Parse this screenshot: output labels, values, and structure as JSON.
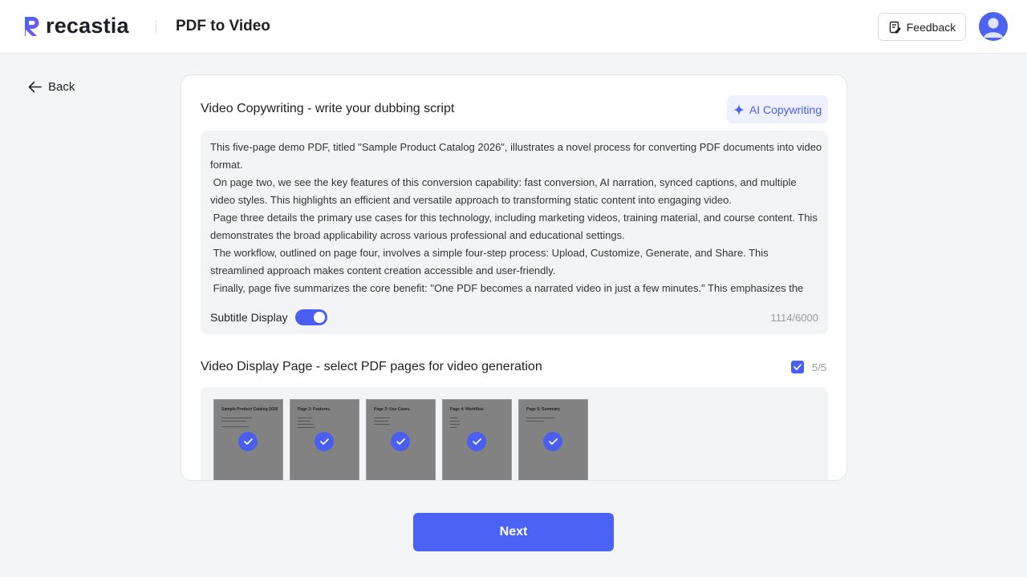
{
  "header": {
    "logo_text": "recastia",
    "page_title": "PDF to Video",
    "feedback_label": "Feedback",
    "avatar_icon": "user-avatar-icon"
  },
  "nav": {
    "back_label": "Back"
  },
  "copywriting": {
    "title": "Video Copywriting - write your dubbing script",
    "ai_button_label": "AI Copywriting",
    "script_text": "This five-page demo PDF, titled \"Sample Product Catalog 2026\", illustrates a novel process for converting PDF documents into video format.\n On page two, we see the key features of this conversion capability: fast conversion, AI narration, synced captions, and multiple video styles. This highlights an efficient and versatile approach to transforming static content into engaging video.\n Page three details the primary use cases for this technology, including marketing videos, training material, and course content. This demonstrates the broad applicability across various professional and educational settings.\n The workflow, outlined on page four, involves a simple four-step process: Upload, Customize, Generate, and Share. This streamlined approach makes content creation accessible and user-friendly.\n Finally, page five summarizes the core benefit: \"One PDF becomes a narrated video in just a few minutes.\" This emphasizes the",
    "subtitle_label": "Subtitle Display",
    "subtitle_enabled": true,
    "char_count": "1114/6000"
  },
  "display_pages": {
    "title": "Video Display Page - select PDF pages for video generation",
    "selected_count": "5/5",
    "all_selected": true,
    "pages": [
      {
        "title": "Sample Product Catalog 2026",
        "selected": true
      },
      {
        "title": "Page 2: Features",
        "selected": true
      },
      {
        "title": "Page 3: Use Cases",
        "selected": true
      },
      {
        "title": "Page 4: Workflow",
        "selected": true
      },
      {
        "title": "Page 5: Summary",
        "selected": true
      }
    ]
  },
  "footer": {
    "next_label": "Next"
  },
  "colors": {
    "accent": "#4a5ef0",
    "next_button": "#4a63f5",
    "card_bg": "#ffffff",
    "page_bg": "#f4f5f7"
  }
}
